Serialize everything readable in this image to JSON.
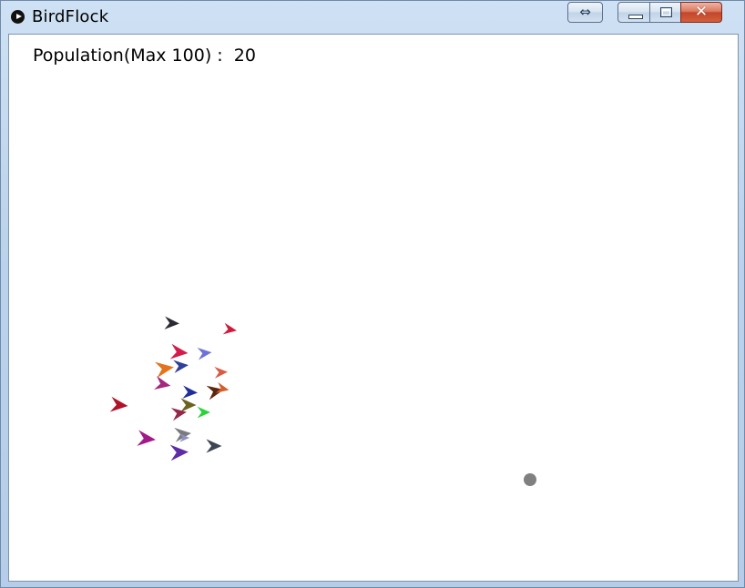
{
  "window": {
    "title": "BirdFlock",
    "icon": "processing-play-icon",
    "controls": {
      "switch_icon": "⇔",
      "minimize_icon": "minimize-icon",
      "maximize_icon": "maximize-icon",
      "close_icon": "✕"
    }
  },
  "hud": {
    "population_label": "Population(Max 100) :",
    "population_value": "20"
  },
  "colors": {
    "window_frame": "#bcd3ec",
    "canvas_background": "#ffffff",
    "close_button": "#c4462a",
    "target_dot": "#808080"
  },
  "birds": [
    {
      "color": "#2b2b35",
      "heading": 0.05
    },
    {
      "color": "#d01a3c",
      "heading": 0.15
    },
    {
      "color": "#d41c4c",
      "heading": 0.1
    },
    {
      "color": "#6d73d6",
      "heading": -0.1
    },
    {
      "color": "#e4731c",
      "heading": -0.15
    },
    {
      "color": "#2f3f9a",
      "heading": -0.1
    },
    {
      "color": "#d95a45",
      "heading": -0.05
    },
    {
      "color": "#a3287e",
      "heading": 0.2
    },
    {
      "color": "#1f2e9b",
      "heading": 0.05
    },
    {
      "color": "#5b2710",
      "heading": -0.2
    },
    {
      "color": "#d65e2a",
      "heading": 0.2
    },
    {
      "color": "#b01228",
      "heading": 0.1
    },
    {
      "color": "#6b6420",
      "heading": 0.0
    },
    {
      "color": "#2bd33a",
      "heading": 0.0
    },
    {
      "color": "#93284a",
      "heading": -0.15
    },
    {
      "color": "#7a7a80",
      "heading": -0.1
    },
    {
      "color": "#a21a8a",
      "heading": 0.1
    },
    {
      "color": "#5e2ca6",
      "heading": -0.05
    },
    {
      "color": "#3d4652",
      "heading": 0.0
    },
    {
      "color": "#8f8fc0",
      "heading": 0.0
    }
  ],
  "target": {
    "color": "#808080"
  }
}
